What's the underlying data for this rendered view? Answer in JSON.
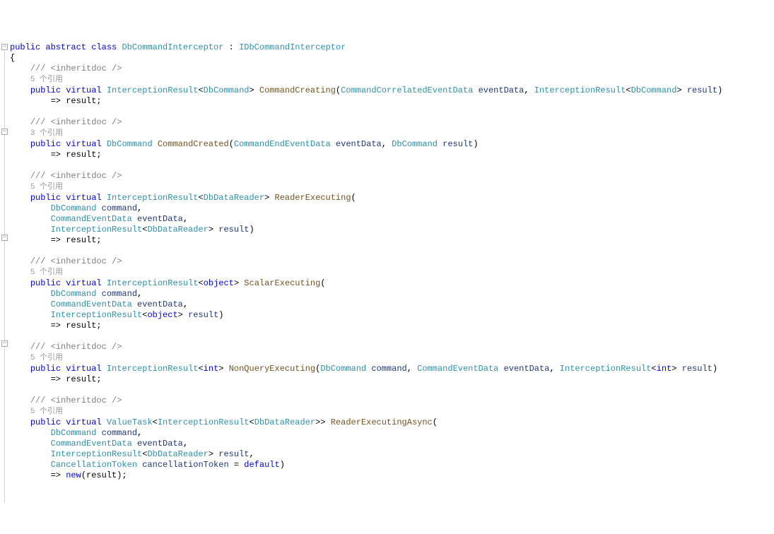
{
  "code": {
    "class_decl": {
      "modifiers": "public abstract class",
      "name": "DbCommandInterceptor",
      "colon": ":",
      "base": "IDbCommandInterceptor"
    },
    "brace_open": "{",
    "m1": {
      "doc": "/// <inheritdoc />",
      "codelens": "5 个引用",
      "sig": {
        "mods": "public virtual",
        "ret_type": "InterceptionResult",
        "ret_gen": "DbCommand",
        "name": "CommandCreating",
        "p1_type": "CommandCorrelatedEventData",
        "p1_name": "eventData",
        "p2_type": "InterceptionResult",
        "p2_gen": "DbCommand",
        "p2_name": "result"
      },
      "body": "=> result;"
    },
    "m2": {
      "doc": "/// <inheritdoc />",
      "codelens": "3 个引用",
      "sig": {
        "mods": "public virtual",
        "ret_type": "DbCommand",
        "name": "CommandCreated",
        "p1_type": "CommandEndEventData",
        "p1_name": "eventData",
        "p2_type": "DbCommand",
        "p2_name": "result"
      },
      "body": "=> result;"
    },
    "m3": {
      "doc": "/// <inheritdoc />",
      "codelens": "5 个引用",
      "sig": {
        "mods": "public virtual",
        "ret_type": "InterceptionResult",
        "ret_gen": "DbDataReader",
        "name": "ReaderExecuting",
        "p1_type": "DbCommand",
        "p1_name": "command",
        "p2_type": "CommandEventData",
        "p2_name": "eventData",
        "p3_type": "InterceptionResult",
        "p3_gen": "DbDataReader",
        "p3_name": "result"
      },
      "body": "=> result;"
    },
    "m4": {
      "doc": "/// <inheritdoc />",
      "codelens": "5 个引用",
      "sig": {
        "mods": "public virtual",
        "ret_type": "InterceptionResult",
        "ret_gen": "object",
        "name": "ScalarExecuting",
        "p1_type": "DbCommand",
        "p1_name": "command",
        "p2_type": "CommandEventData",
        "p2_name": "eventData",
        "p3_type": "InterceptionResult",
        "p3_gen": "object",
        "p3_name": "result"
      },
      "body": "=> result;"
    },
    "m5": {
      "doc": "/// <inheritdoc />",
      "codelens": "5 个引用",
      "sig": {
        "mods": "public virtual",
        "ret_type": "InterceptionResult",
        "ret_gen": "int",
        "name": "NonQueryExecuting",
        "p1_type": "DbCommand",
        "p1_name": "command",
        "p2_type": "CommandEventData",
        "p2_name": "eventData",
        "p3_type": "InterceptionResult",
        "p3_gen": "int",
        "p3_name": "result"
      },
      "body": "=> result;"
    },
    "m6": {
      "doc": "/// <inheritdoc />",
      "codelens": "5 个引用",
      "sig": {
        "mods": "public virtual",
        "ret_type": "ValueTask",
        "ret_gen1": "InterceptionResult",
        "ret_gen2": "DbDataReader",
        "name": "ReaderExecutingAsync",
        "p1_type": "DbCommand",
        "p1_name": "command",
        "p2_type": "CommandEventData",
        "p2_name": "eventData",
        "p3_type": "InterceptionResult",
        "p3_gen": "DbDataReader",
        "p3_name": "result",
        "p4_type": "CancellationToken",
        "p4_name": "cancellationToken",
        "p4_default": "default"
      },
      "body_arrow": "=>",
      "body_new": "new",
      "body_arg": "(result);"
    }
  }
}
